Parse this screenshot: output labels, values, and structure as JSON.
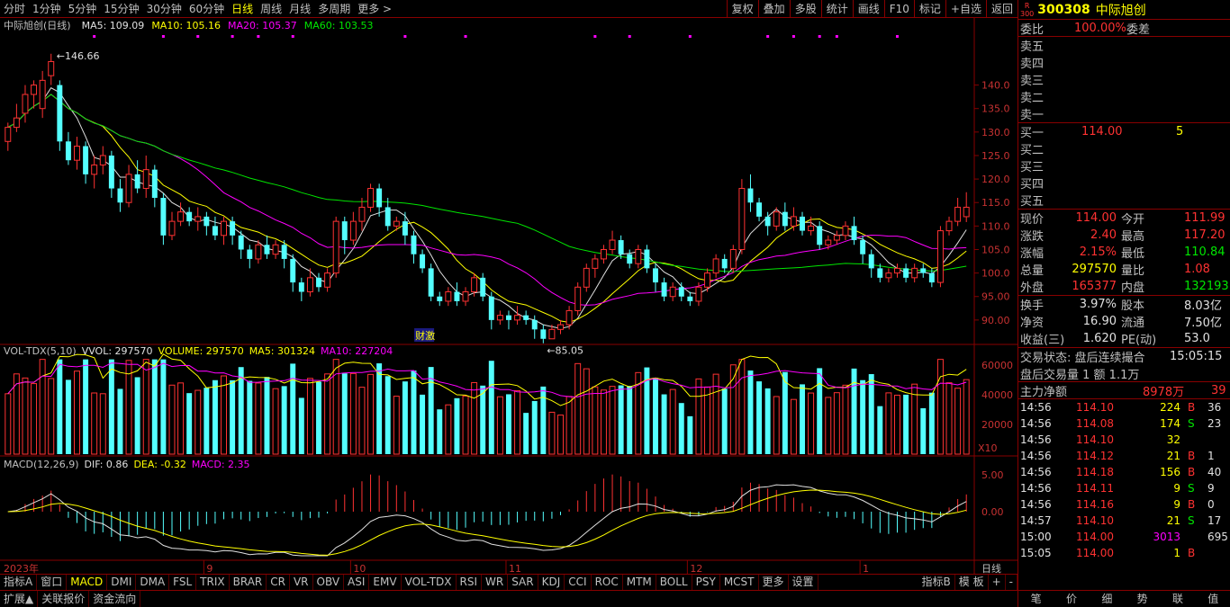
{
  "toolbar": {
    "periods": [
      "分时",
      "1分钟",
      "5分钟",
      "15分钟",
      "30分钟",
      "60分钟",
      "日线",
      "周线",
      "月线",
      "多周期",
      "更多 >"
    ],
    "active": 6,
    "right": [
      "复权",
      "叠加",
      "多股",
      "统计",
      "画线",
      "F10",
      "标记",
      "+自选",
      "返回"
    ]
  },
  "chart": {
    "title": "中际旭创(日线)",
    "ma_legend": [
      {
        "text": "MA5: 109.09",
        "color": "#e0e0e0"
      },
      {
        "text": "MA10: 105.16",
        "color": "#ffff00"
      },
      {
        "text": "MA20: 105.37",
        "color": "#ff00ff"
      },
      {
        "text": "MA60: 103.53",
        "color": "#00e600"
      }
    ],
    "high_label": "146.66",
    "low_label": "85.05",
    "fin_label": "财",
    "fin_label2": "激",
    "price_ticks": [
      "140.0",
      "135.0",
      "130.0",
      "125.0",
      "120.0",
      "115.0",
      "110.0",
      "105.0",
      "100.0",
      "95.00",
      "90.00"
    ],
    "vol_legend": [
      {
        "text": "VOL-TDX(5,10)",
        "color": "#c0c0c0"
      },
      {
        "text": "VVOL: 297570",
        "color": "#e0e0e0"
      },
      {
        "text": "VOLUME: 297570",
        "color": "#ffff00"
      },
      {
        "text": "MA5: 301324",
        "color": "#ffff00"
      },
      {
        "text": "MA10: 227204",
        "color": "#ff00ff"
      }
    ],
    "vol_ticks": [
      "60000",
      "40000",
      "20000"
    ],
    "vol_unit": "X10",
    "macd_legend": [
      {
        "text": "MACD(12,26,9)",
        "color": "#c0c0c0"
      },
      {
        "text": "DIF: 0.86",
        "color": "#e0e0e0"
      },
      {
        "text": "DEA: -0.32",
        "color": "#ffff00"
      },
      {
        "text": "MACD: 2.35",
        "color": "#ff00ff"
      }
    ],
    "macd_ticks": [
      "5.00",
      "0.00"
    ],
    "date_labels": [
      "2023年",
      "9",
      "10",
      "11",
      "12",
      "1"
    ],
    "period_label": "日线"
  },
  "chart_data": {
    "type": "candlestick",
    "price_ylim": [
      85,
      147
    ],
    "price_gridlines": [
      90,
      95,
      100,
      105,
      110,
      115,
      120,
      125,
      130,
      135,
      140
    ],
    "candles": [
      [
        128,
        131,
        126,
        132
      ],
      [
        131,
        133,
        130,
        136
      ],
      [
        134,
        138,
        132,
        140
      ],
      [
        138,
        140,
        135,
        141
      ],
      [
        135,
        141,
        133,
        143
      ],
      [
        142,
        145,
        140,
        146.66
      ],
      [
        140,
        128,
        126,
        141
      ],
      [
        128,
        124,
        123,
        130
      ],
      [
        124,
        127,
        122,
        129
      ],
      [
        127,
        121,
        119,
        128
      ],
      [
        121,
        123,
        118,
        125
      ],
      [
        123,
        125,
        121,
        127
      ],
      [
        125,
        118,
        116,
        126
      ],
      [
        118,
        115,
        113,
        120
      ],
      [
        115,
        121,
        114,
        123
      ],
      [
        121,
        118,
        117,
        124
      ],
      [
        118,
        122,
        116,
        125
      ],
      [
        122,
        116,
        114,
        123
      ],
      [
        116,
        108,
        106,
        117
      ],
      [
        108,
        111,
        107,
        113
      ],
      [
        111,
        113,
        110,
        115
      ],
      [
        113,
        111,
        110,
        114
      ],
      [
        111,
        112,
        109,
        114
      ],
      [
        112,
        110,
        108,
        113
      ],
      [
        110,
        108,
        107,
        112
      ],
      [
        108,
        111,
        106,
        112
      ],
      [
        111,
        108,
        106,
        112
      ],
      [
        108,
        105,
        103,
        109
      ],
      [
        105,
        103,
        101,
        106
      ],
      [
        103,
        106,
        102,
        107
      ],
      [
        106,
        104,
        103,
        108
      ],
      [
        104,
        106,
        103,
        107
      ],
      [
        106,
        103,
        101,
        107
      ],
      [
        103,
        98,
        96,
        104
      ],
      [
        98,
        96,
        94,
        99
      ],
      [
        96,
        99,
        95,
        101
      ],
      [
        99,
        97,
        96,
        100
      ],
      [
        97,
        100,
        96,
        101
      ],
      [
        100,
        111,
        99,
        112
      ],
      [
        111,
        107,
        104,
        112
      ],
      [
        107,
        111,
        106,
        113
      ],
      [
        111,
        114,
        109,
        116
      ],
      [
        114,
        118,
        113,
        119
      ],
      [
        118,
        114,
        112,
        119
      ],
      [
        114,
        110,
        109,
        116
      ],
      [
        110,
        111,
        109,
        112
      ],
      [
        111,
        108,
        106,
        113
      ],
      [
        108,
        104,
        102,
        109
      ],
      [
        104,
        101,
        100,
        105
      ],
      [
        101,
        95,
        94,
        102
      ],
      [
        95,
        94,
        93,
        96
      ],
      [
        94,
        96,
        93,
        97
      ],
      [
        96,
        94,
        93,
        98
      ],
      [
        94,
        96,
        93,
        97
      ],
      [
        96,
        99,
        95,
        100
      ],
      [
        99,
        95,
        94,
        100
      ],
      [
        95,
        90,
        88,
        96
      ],
      [
        90,
        91,
        89,
        92
      ],
      [
        91,
        90,
        88,
        92
      ],
      [
        90,
        91,
        89,
        93
      ],
      [
        91,
        90,
        89,
        92
      ],
      [
        90,
        88,
        86,
        91
      ],
      [
        88,
        86,
        85.05,
        89
      ],
      [
        86,
        88,
        86,
        89
      ],
      [
        88,
        89,
        87,
        90
      ],
      [
        89,
        92,
        88,
        93
      ],
      [
        92,
        97,
        91,
        98
      ],
      [
        97,
        101,
        96,
        102
      ],
      [
        101,
        103,
        99,
        104
      ],
      [
        103,
        105,
        102,
        106
      ],
      [
        105,
        107,
        104,
        109
      ],
      [
        107,
        104,
        103,
        108
      ],
      [
        104,
        102,
        101,
        105
      ],
      [
        102,
        105,
        101,
        106
      ],
      [
        105,
        101,
        100,
        106
      ],
      [
        101,
        98,
        96,
        102
      ],
      [
        98,
        95,
        94,
        99
      ],
      [
        95,
        97,
        94,
        98
      ],
      [
        97,
        95,
        94,
        98
      ],
      [
        95,
        94,
        93,
        96
      ],
      [
        94,
        97,
        93,
        98
      ],
      [
        97,
        100,
        96,
        101
      ],
      [
        100,
        103,
        99,
        104
      ],
      [
        103,
        101,
        100,
        104
      ],
      [
        101,
        105,
        100,
        106
      ],
      [
        105,
        118,
        104,
        120
      ],
      [
        118,
        115,
        113,
        121
      ],
      [
        115,
        112,
        111,
        116
      ],
      [
        112,
        110,
        108,
        113
      ],
      [
        110,
        113,
        109,
        114
      ],
      [
        113,
        110,
        109,
        115
      ],
      [
        110,
        112,
        109,
        114
      ],
      [
        112,
        109,
        108,
        113
      ],
      [
        109,
        110,
        108,
        112
      ],
      [
        110,
        106,
        105,
        111
      ],
      [
        106,
        107,
        105,
        108
      ],
      [
        107,
        108,
        106,
        109
      ],
      [
        108,
        110,
        107,
        111
      ],
      [
        110,
        107,
        106,
        112
      ],
      [
        107,
        104,
        102,
        108
      ],
      [
        104,
        101,
        99,
        105
      ],
      [
        101,
        99,
        98,
        102
      ],
      [
        99,
        100,
        98,
        101
      ],
      [
        100,
        101,
        99,
        102
      ],
      [
        101,
        99,
        98,
        102
      ],
      [
        99,
        101,
        98,
        102
      ],
      [
        101,
        100,
        99,
        102
      ],
      [
        100,
        98,
        97,
        101
      ],
      [
        98,
        109,
        97,
        110
      ],
      [
        109,
        111,
        108,
        112
      ],
      [
        111,
        114,
        110,
        116
      ],
      [
        111.99,
        114,
        110.84,
        117.2
      ]
    ],
    "vol_ylim": [
      0,
      65000
    ],
    "macd_ylim": [
      -6,
      6
    ]
  }
}
